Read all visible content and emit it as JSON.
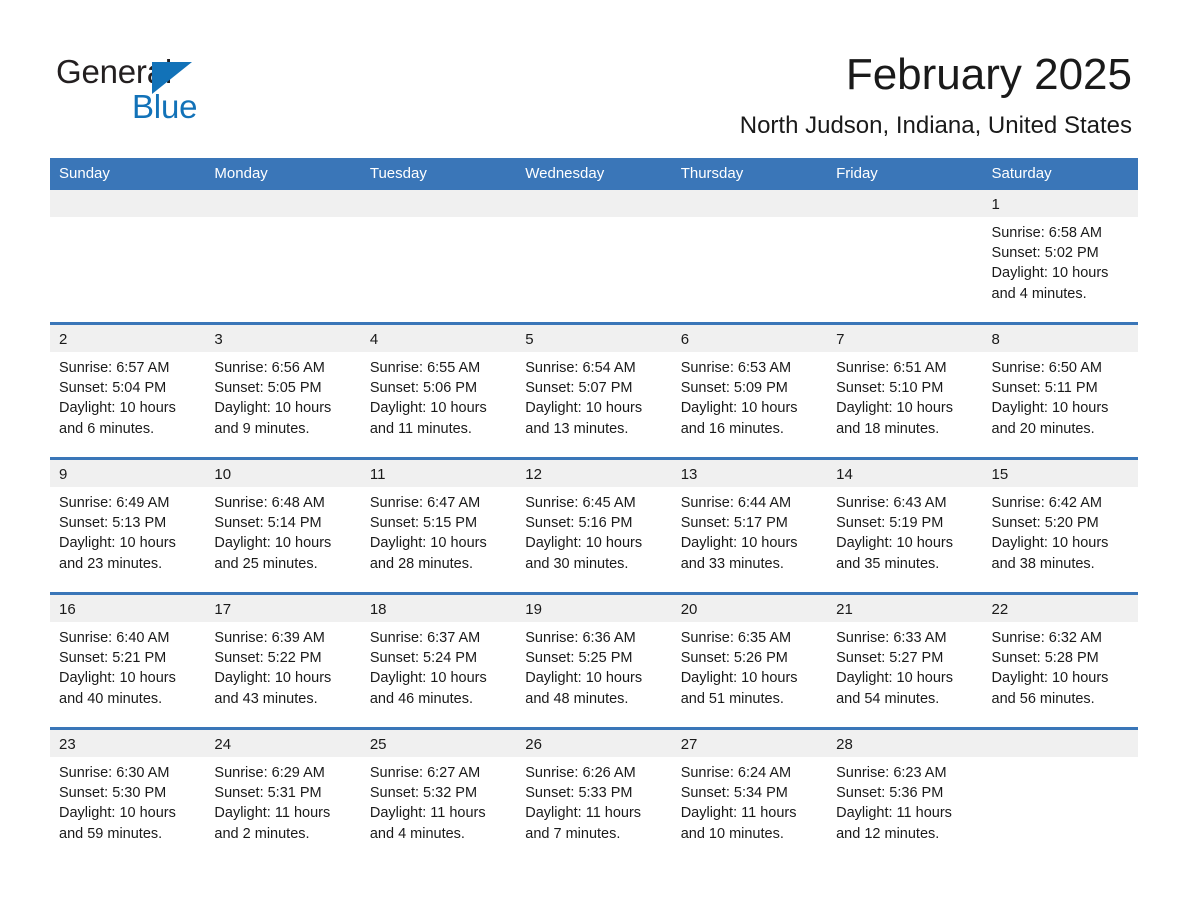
{
  "logo": {
    "word1": "General",
    "word2": "Blue",
    "triangle_color": "#1272b8",
    "icon": "triangle-logo-icon"
  },
  "header": {
    "month_title": "February 2025",
    "location": "North Judson, Indiana, United States"
  },
  "colors": {
    "header_blue": "#3a76b8",
    "daynum_band": "#f0f0f0",
    "logo_blue": "#1272b8",
    "text": "#1a1a1a"
  },
  "calendar": {
    "weekday_headers": [
      "Sunday",
      "Monday",
      "Tuesday",
      "Wednesday",
      "Thursday",
      "Friday",
      "Saturday"
    ],
    "weeks": [
      [
        {
          "day": "",
          "empty": true,
          "info": ""
        },
        {
          "day": "",
          "empty": true,
          "info": ""
        },
        {
          "day": "",
          "empty": true,
          "info": ""
        },
        {
          "day": "",
          "empty": true,
          "info": ""
        },
        {
          "day": "",
          "empty": true,
          "info": ""
        },
        {
          "day": "",
          "empty": true,
          "info": ""
        },
        {
          "day": "1",
          "empty": false,
          "info": "Sunrise: 6:58 AM\nSunset: 5:02 PM\nDaylight: 10 hours and 4 minutes."
        }
      ],
      [
        {
          "day": "2",
          "empty": false,
          "info": "Sunrise: 6:57 AM\nSunset: 5:04 PM\nDaylight: 10 hours and 6 minutes."
        },
        {
          "day": "3",
          "empty": false,
          "info": "Sunrise: 6:56 AM\nSunset: 5:05 PM\nDaylight: 10 hours and 9 minutes."
        },
        {
          "day": "4",
          "empty": false,
          "info": "Sunrise: 6:55 AM\nSunset: 5:06 PM\nDaylight: 10 hours and 11 minutes."
        },
        {
          "day": "5",
          "empty": false,
          "info": "Sunrise: 6:54 AM\nSunset: 5:07 PM\nDaylight: 10 hours and 13 minutes."
        },
        {
          "day": "6",
          "empty": false,
          "info": "Sunrise: 6:53 AM\nSunset: 5:09 PM\nDaylight: 10 hours and 16 minutes."
        },
        {
          "day": "7",
          "empty": false,
          "info": "Sunrise: 6:51 AM\nSunset: 5:10 PM\nDaylight: 10 hours and 18 minutes."
        },
        {
          "day": "8",
          "empty": false,
          "info": "Sunrise: 6:50 AM\nSunset: 5:11 PM\nDaylight: 10 hours and 20 minutes."
        }
      ],
      [
        {
          "day": "9",
          "empty": false,
          "info": "Sunrise: 6:49 AM\nSunset: 5:13 PM\nDaylight: 10 hours and 23 minutes."
        },
        {
          "day": "10",
          "empty": false,
          "info": "Sunrise: 6:48 AM\nSunset: 5:14 PM\nDaylight: 10 hours and 25 minutes."
        },
        {
          "day": "11",
          "empty": false,
          "info": "Sunrise: 6:47 AM\nSunset: 5:15 PM\nDaylight: 10 hours and 28 minutes."
        },
        {
          "day": "12",
          "empty": false,
          "info": "Sunrise: 6:45 AM\nSunset: 5:16 PM\nDaylight: 10 hours and 30 minutes."
        },
        {
          "day": "13",
          "empty": false,
          "info": "Sunrise: 6:44 AM\nSunset: 5:17 PM\nDaylight: 10 hours and 33 minutes."
        },
        {
          "day": "14",
          "empty": false,
          "info": "Sunrise: 6:43 AM\nSunset: 5:19 PM\nDaylight: 10 hours and 35 minutes."
        },
        {
          "day": "15",
          "empty": false,
          "info": "Sunrise: 6:42 AM\nSunset: 5:20 PM\nDaylight: 10 hours and 38 minutes."
        }
      ],
      [
        {
          "day": "16",
          "empty": false,
          "info": "Sunrise: 6:40 AM\nSunset: 5:21 PM\nDaylight: 10 hours and 40 minutes."
        },
        {
          "day": "17",
          "empty": false,
          "info": "Sunrise: 6:39 AM\nSunset: 5:22 PM\nDaylight: 10 hours and 43 minutes."
        },
        {
          "day": "18",
          "empty": false,
          "info": "Sunrise: 6:37 AM\nSunset: 5:24 PM\nDaylight: 10 hours and 46 minutes."
        },
        {
          "day": "19",
          "empty": false,
          "info": "Sunrise: 6:36 AM\nSunset: 5:25 PM\nDaylight: 10 hours and 48 minutes."
        },
        {
          "day": "20",
          "empty": false,
          "info": "Sunrise: 6:35 AM\nSunset: 5:26 PM\nDaylight: 10 hours and 51 minutes."
        },
        {
          "day": "21",
          "empty": false,
          "info": "Sunrise: 6:33 AM\nSunset: 5:27 PM\nDaylight: 10 hours and 54 minutes."
        },
        {
          "day": "22",
          "empty": false,
          "info": "Sunrise: 6:32 AM\nSunset: 5:28 PM\nDaylight: 10 hours and 56 minutes."
        }
      ],
      [
        {
          "day": "23",
          "empty": false,
          "info": "Sunrise: 6:30 AM\nSunset: 5:30 PM\nDaylight: 10 hours and 59 minutes."
        },
        {
          "day": "24",
          "empty": false,
          "info": "Sunrise: 6:29 AM\nSunset: 5:31 PM\nDaylight: 11 hours and 2 minutes."
        },
        {
          "day": "25",
          "empty": false,
          "info": "Sunrise: 6:27 AM\nSunset: 5:32 PM\nDaylight: 11 hours and 4 minutes."
        },
        {
          "day": "26",
          "empty": false,
          "info": "Sunrise: 6:26 AM\nSunset: 5:33 PM\nDaylight: 11 hours and 7 minutes."
        },
        {
          "day": "27",
          "empty": false,
          "info": "Sunrise: 6:24 AM\nSunset: 5:34 PM\nDaylight: 11 hours and 10 minutes."
        },
        {
          "day": "28",
          "empty": false,
          "info": "Sunrise: 6:23 AM\nSunset: 5:36 PM\nDaylight: 11 hours and 12 minutes."
        },
        {
          "day": "",
          "empty": true,
          "info": ""
        }
      ]
    ]
  }
}
